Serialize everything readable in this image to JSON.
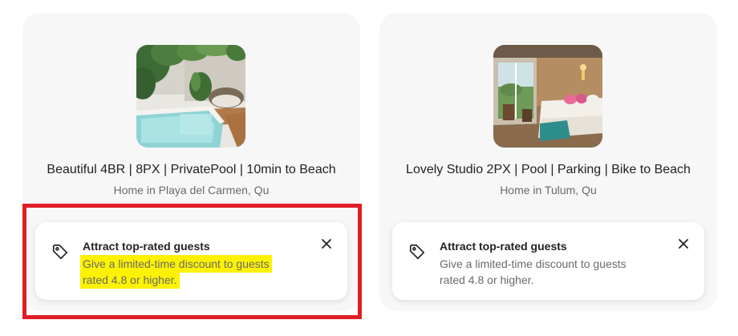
{
  "listings": [
    {
      "title": "Beautiful 4BR | 8PX | PrivatePool | 10min to Beach",
      "subtitle": "Home in Playa del Carmen, Qu",
      "tip": {
        "icon": "tag-icon",
        "title": "Attract top-rated guests",
        "body_line1": "Give a limited-time discount to guests",
        "body_line2": "rated 4.8 or higher.",
        "close_icon": "close-icon"
      }
    },
    {
      "title": "Lovely Studio 2PX | Pool | Parking | Bike to Beach",
      "subtitle": "Home in Tulum, Qu",
      "tip": {
        "icon": "tag-icon",
        "title": "Attract top-rated guests",
        "body_line1": "Give a limited-time discount to guests",
        "body_line2": "rated 4.8 or higher.",
        "close_icon": "close-icon"
      }
    }
  ],
  "colors": {
    "card_background": "#f7f7f7",
    "highlight": "#fdf104",
    "annotation_frame": "#e01e24",
    "secondary_text": "#6a6a6a"
  }
}
